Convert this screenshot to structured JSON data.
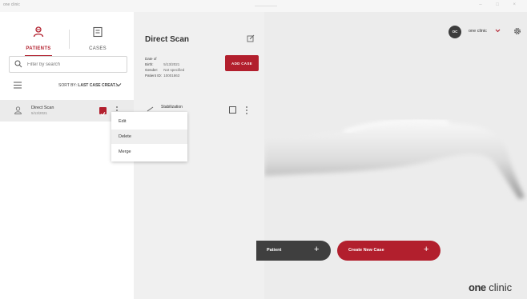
{
  "window": {
    "app_title": "one clinic"
  },
  "nav": {
    "patients_label": "PATIENTS",
    "cases_label": "CASES"
  },
  "search": {
    "placeholder": "Filter by search"
  },
  "sort": {
    "prefix": "SORT BY:",
    "value": "LAST CASE CREAT..."
  },
  "patients": [
    {
      "name": "Direct Scan",
      "date": "5/13/2021",
      "selected": true
    }
  ],
  "context_menu": {
    "items": [
      {
        "label": "Edit"
      },
      {
        "label": "Delete"
      },
      {
        "label": "Merge"
      }
    ]
  },
  "detail": {
    "title": "Direct Scan",
    "meta": [
      {
        "key": "Date of Birth:",
        "value": "5/13/2021"
      },
      {
        "key": "Gender:",
        "value": "Not specified"
      },
      {
        "key": "Patient ID:",
        "value": "10001863"
      }
    ],
    "add_case_label": "ADD CASE",
    "case_item": {
      "name": "Stabilization"
    }
  },
  "user": {
    "initials": "OC",
    "name": "one clinic"
  },
  "actions": {
    "patient_label": "Patient",
    "create_case_label": "Create New Case",
    "plus": "+"
  },
  "brand": {
    "part1": "one",
    "part2": " clinic"
  },
  "colors": {
    "accent": "#b21f2d",
    "dark_button": "#3f3f3f"
  }
}
